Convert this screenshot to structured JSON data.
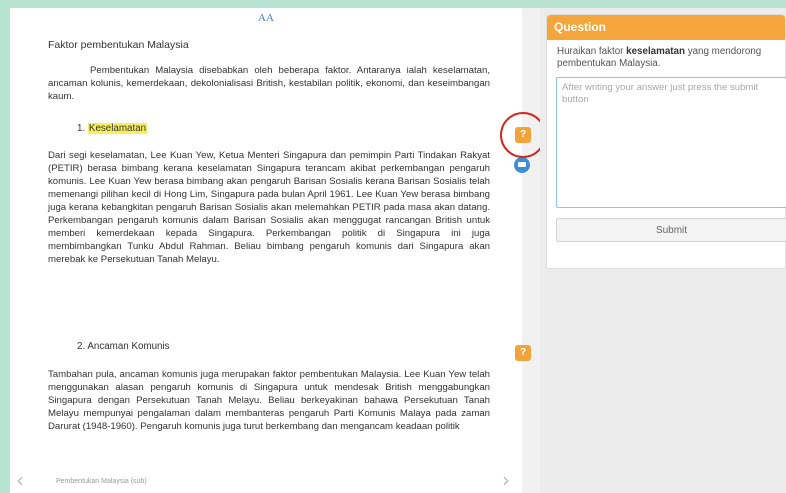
{
  "reader": {
    "font_size_toggle": "AA",
    "doc_title": "Faktor pembentukan Malaysia",
    "intro": "Pembentukan Malaysia disebabkan oleh beberapa faktor. Antaranya ialah keselamatan, ancaman kolunis, kemerdekaan, dekolonialisasi British, kestabilan politik, ekonomi, dan keseimbangan kaum.",
    "section1_number": "1.",
    "section1_title": "Keselamatan",
    "section1_text": "Dari segi keselamatan, Lee  Kuan Yew, Ketua Menteri Singapura dan pemimpin Parti Tindakan Rakyat (PETIR) berasa bimbang kerana keselamatan Singapura terancam akibat perkembangan pengaruh komunis. Lee Kuan Yew berasa bimbang akan pengaruh Barisan Sosialis kerana Barisan Sosialis telah memenangi pilihan kecil di Hong Lim, Singapura pada bulan April 1961. Lee Kuan Yew berasa bimbang juga kerana kebangkitan pengaruh Barisan Sosialis akan melemahkan PETIR pada masa akan datang. Perkembangan pengaruh komunis dalam Barisan Sosialis akan menggugat rancangan British untuk memberi kemerdekaan kepada Singapura. Perkembangan politik di Singapura ini juga membimbangkan Tunku Abdul Rahman. Beliau bimbang pengaruh komunis dari Singapura akan merebak ke Persekutuan Tanah Melayu.",
    "section2_heading": "2. Ancaman Komunis",
    "section2_text": "Tambahan pula, ancaman komunis juga merupakan faktor pembentukan Malaysia. Lee Kuan Yew telah menggunakan alasan pengaruh komunis di Singapura untuk mendesak British menggabungkan Singapura dengan Persekutuan Tanah Melayu. Beliau berkeyakinan bahawa Persekutuan Tanah Melayu mempunyai pengalaman dalam membanteras pengaruh Parti Komunis Malaya pada zaman Darurat (1948-1960). Pengaruh komunis juga turut berkembang dan mengancam keadaan politik",
    "footer_label": "Pembentukan Malaysia (sub)",
    "prev_arrow": "‹",
    "next_arrow": "›"
  },
  "markers": {
    "question_glyph": "?",
    "question_icon": "question-icon",
    "chat_icon": "chat-icon"
  },
  "question_panel": {
    "header": "Question",
    "prompt_before": "Huraikan faktor ",
    "prompt_bold": "keselamatan",
    "prompt_after": " yang mendorong pembentukan Malaysia.",
    "answer_placeholder": "After writing your answer just press the submit button",
    "answer_value": "",
    "submit_label": "Submit"
  },
  "colors": {
    "background": "#b7e3d3",
    "accent_orange": "#f4a63c",
    "highlight_yellow": "#f7f05a",
    "chat_blue": "#3c8fd6",
    "annotation_red": "#d0261e"
  }
}
